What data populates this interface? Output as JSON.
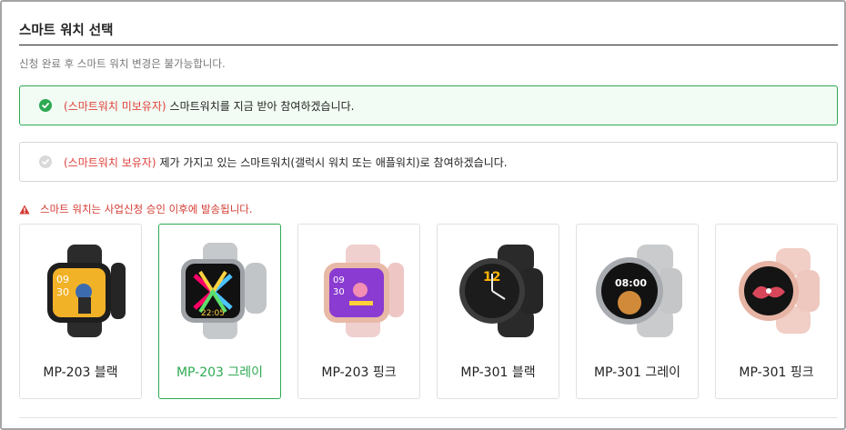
{
  "section": {
    "title": "스마트 워치 선택",
    "note": "신청 완료 후 스마트 워치 변경은 불가능합니다."
  },
  "options": [
    {
      "highlight": "(스마트워치 미보유자)",
      "text": "스마트워치를 지금 받아 참여하겠습니다.",
      "selected": true
    },
    {
      "highlight": "(스마트워치 보유자)",
      "text": "제가 가지고 있는 스마트워치(갤럭시 워치 또는 애플워치)로 참여하겠습니다.",
      "selected": false
    }
  ],
  "warning": "스마트 워치는 사업신청 승인 이후에 발송됩니다.",
  "watches": [
    {
      "label": "MP-203 블랙",
      "selected": false,
      "shape": "square",
      "band": "#2b2b2b",
      "face": "#f2b227"
    },
    {
      "label": "MP-203 그레이",
      "selected": true,
      "shape": "square",
      "band": "#c6c9cc",
      "face": "#111111",
      "screen_time": "22:05"
    },
    {
      "label": "MP-203 핑크",
      "selected": false,
      "shape": "square",
      "band": "#f0cfcf",
      "face": "#8a3bd1"
    },
    {
      "label": "MP-301 블랙",
      "selected": false,
      "shape": "round",
      "band": "#2a2a2a",
      "face": "#1c1c1c",
      "screen_time": "12"
    },
    {
      "label": "MP-301 그레이",
      "selected": false,
      "shape": "round",
      "band": "#c9cbcd",
      "face": "#121212",
      "screen_time": "08:00"
    },
    {
      "label": "MP-301 핑크",
      "selected": false,
      "shape": "round",
      "band": "#f1cfc6",
      "face": "#141414"
    }
  ],
  "colors": {
    "accent": "#2eaa52",
    "highlight": "#e0413a",
    "warning": "#d33a32"
  }
}
